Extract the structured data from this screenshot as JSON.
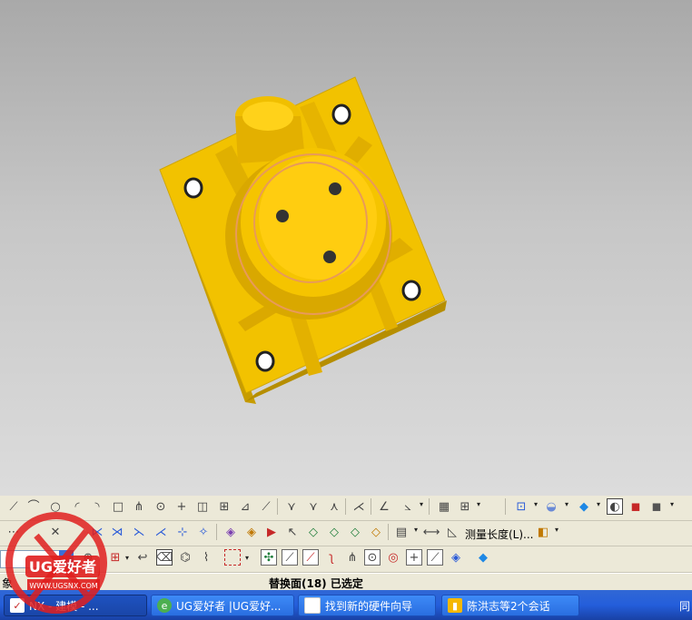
{
  "viewport": {
    "bg_top": "#a9a9a9",
    "bg_bottom": "#dcdcdc",
    "part_color": "#f2c200",
    "part_shadow": "#b58f00",
    "highlight_color": "#e89a5a"
  },
  "toolbar": {
    "measure_label": "测量长度(L)..."
  },
  "status_bar": {
    "left_text": "象",
    "selection_text": "替换面(18) 已选定"
  },
  "taskbar": {
    "items": [
      {
        "label": "NX - 建模 - ...",
        "icon": "nx-icon"
      },
      {
        "label": "UG爱好者 |UG爱好...",
        "icon": "browser-icon"
      },
      {
        "label": "找到新的硬件向导",
        "icon": "window-icon"
      },
      {
        "label": "陈洪志等2个会话",
        "icon": "chat-icon"
      }
    ],
    "tray_text": "同"
  },
  "watermark": {
    "brand": "UG爱好者",
    "url": "WWW.UGSNX.COM"
  }
}
